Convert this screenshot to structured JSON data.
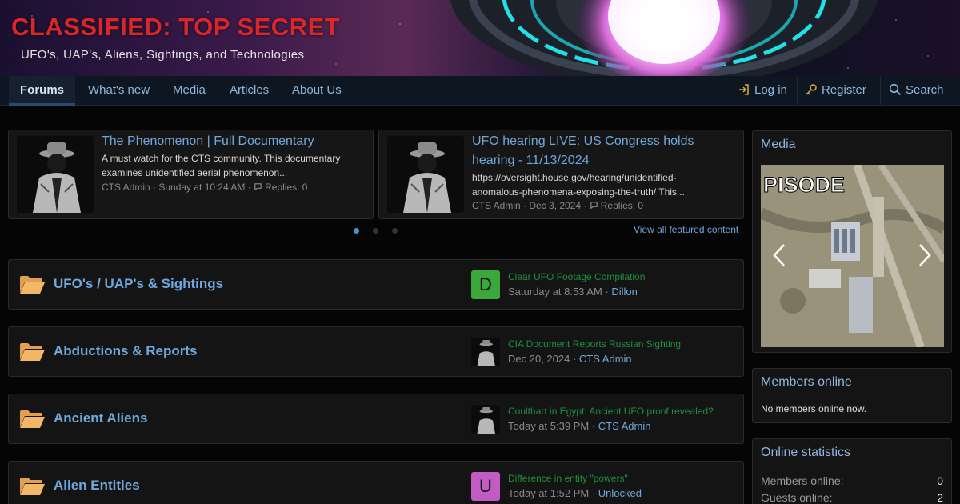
{
  "header": {
    "site_title": "CLASSIFIED: TOP SECRET",
    "tagline": "UFO's, UAP's, Aliens, Sightings, and Technologies"
  },
  "nav": {
    "items": [
      "Forums",
      "What's new",
      "Media",
      "Articles",
      "About Us"
    ],
    "login": "Log in",
    "register": "Register",
    "search": "Search"
  },
  "featured": [
    {
      "title": "The Phenomenon | Full Documentary",
      "snippet_1": "A must watch for the CTS community. This documentary",
      "snippet_2": "examines unidentified aerial phenomenon...",
      "meta": "CTS Admin · Sunday at 10:24 AM · ",
      "replies": "Replies: 0"
    },
    {
      "title_1": "UFO hearing LIVE: US Congress holds",
      "title_2": "hearing - 11/13/2024",
      "snippet_1": "https://oversight.house.gov/hearing/unidentified-",
      "snippet_2": "anomalous-phenomena-exposing-the-truth/ This...",
      "meta": "CTS Admin · Dec 3, 2024 · ",
      "replies": "Replies: 0"
    }
  ],
  "view_all": "View all featured content",
  "forums": [
    {
      "name": "UFO's / UAP's & Sightings",
      "avatar_letter": "D",
      "avatar_color": "#3aa83a",
      "last_title": "Clear UFO Footage Compilation",
      "last_time": "Saturday at 8:53 AM",
      "last_user": "Dillon"
    },
    {
      "name": "Abductions & Reports",
      "last_title": "CIA Document Reports Russian Sighting",
      "last_time": "Dec 20, 2024",
      "last_user": "CTS Admin"
    },
    {
      "name": "Ancient Aliens",
      "last_title": "Coulthart in Egypt: Ancient UFO proof revealed?",
      "last_time": "Today at 5:39 PM",
      "last_user": "CTS Admin"
    },
    {
      "name": "Alien Entities",
      "avatar_letter": "U",
      "avatar_color": "#c25bc2",
      "last_title": "Difference in entity \"powers\"",
      "last_time": "Today at 1:52 PM",
      "last_user": "Unlocked"
    }
  ],
  "sidebar": {
    "media_title": "Media",
    "media_caption": "PISODE",
    "members_title": "Members online",
    "members_text": "No members online now.",
    "stats_title": "Online statistics",
    "stats": [
      {
        "label": "Members online:",
        "value": "0"
      },
      {
        "label": "Guests online:",
        "value": "2"
      }
    ]
  },
  "separator": " · "
}
